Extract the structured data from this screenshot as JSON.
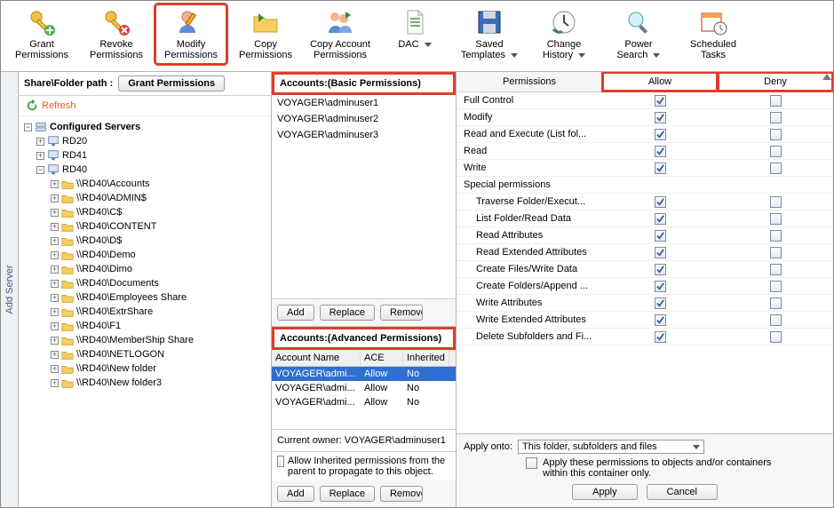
{
  "toolbar": [
    {
      "id": "grant-permissions",
      "label": "Grant\nPermissions",
      "icon": "key-plus",
      "dropdown": false
    },
    {
      "id": "revoke-permissions",
      "label": "Revoke\nPermissions",
      "icon": "key-x",
      "dropdown": false
    },
    {
      "id": "modify-permissions",
      "label": "Modify\nPermissions",
      "icon": "user-pencil",
      "highlight": true,
      "dropdown": false
    },
    {
      "id": "copy-permissions",
      "label": "Copy\nPermissions",
      "icon": "folder-arrow",
      "dropdown": false
    },
    {
      "id": "copy-account-permissions",
      "label": "Copy Account\nPermissions",
      "icon": "users-arrow",
      "dropdown": false
    },
    {
      "id": "dac",
      "label": "DAC",
      "icon": "document",
      "dropdown": true
    },
    {
      "id": "saved-templates",
      "label": "Saved\nTemplates",
      "icon": "floppy",
      "dropdown": true
    },
    {
      "id": "change-history",
      "label": "Change\nHistory",
      "icon": "clock",
      "dropdown": true
    },
    {
      "id": "power-search",
      "label": "Power\nSearch",
      "icon": "magnifier",
      "dropdown": true
    },
    {
      "id": "scheduled-tasks",
      "label": "Scheduled\nTasks",
      "icon": "calendar-clock",
      "dropdown": false
    }
  ],
  "side_tab": "Add Server",
  "left": {
    "path_label": "Share\\Folder path :",
    "grant_btn": "Grant Permissions",
    "refresh": "Refresh",
    "root": "Configured Servers",
    "servers": [
      {
        "name": "RD20",
        "expanded": false
      },
      {
        "name": "RD41",
        "expanded": false
      },
      {
        "name": "RD40",
        "expanded": true,
        "children": [
          "\\\\RD40\\Accounts",
          "\\\\RD40\\ADMIN$",
          "\\\\RD40\\C$",
          "\\\\RD40\\CONTENT",
          "\\\\RD40\\D$",
          "\\\\RD40\\Demo",
          "\\\\RD40\\Dimo",
          "\\\\RD40\\Documents",
          "\\\\RD40\\Employees Share",
          "\\\\RD40\\ExtrShare",
          "\\\\RD40\\F1",
          "\\\\RD40\\MemberShip Share",
          "\\\\RD40\\NETLOGON",
          "\\\\RD40\\New folder",
          "\\\\RD40\\New folder3"
        ]
      }
    ]
  },
  "mid": {
    "basic_header": "Accounts:(Basic Permissions)",
    "basic_accounts": [
      "VOYAGER\\adminuser1",
      "VOYAGER\\adminuser2",
      "VOYAGER\\adminuser3"
    ],
    "btn_add": "Add",
    "btn_replace": "Replace",
    "btn_remove": "Remove",
    "adv_header": "Accounts:(Advanced Permissions)",
    "adv_cols": {
      "name": "Account Name",
      "ace": "ACE",
      "inherited": "Inherited"
    },
    "adv_rows": [
      {
        "name": "VOYAGER\\admi...",
        "ace": "Allow",
        "inherited": "No",
        "selected": true
      },
      {
        "name": "VOYAGER\\admi...",
        "ace": "Allow",
        "inherited": "No"
      },
      {
        "name": "VOYAGER\\admi...",
        "ace": "Allow",
        "inherited": "No"
      }
    ],
    "owner_label": "Current owner: VOYAGER\\adminuser1",
    "inherit_label": "Allow Inherited permissions from the parent to propagate to this object."
  },
  "right": {
    "head_perm": "Permissions",
    "head_allow": "Allow",
    "head_deny": "Deny",
    "rows": [
      {
        "label": "Full Control",
        "allow": true,
        "deny": false
      },
      {
        "label": "Modify",
        "allow": true,
        "deny": false
      },
      {
        "label": "Read and Execute (List fol...",
        "allow": true,
        "deny": false
      },
      {
        "label": "Read",
        "allow": true,
        "deny": false
      },
      {
        "label": "Write",
        "allow": true,
        "deny": false
      },
      {
        "label": "Special permissions",
        "allow": null,
        "deny": null,
        "section": true
      },
      {
        "label": "Traverse Folder/Execut...",
        "allow": true,
        "deny": false,
        "sub": true
      },
      {
        "label": "List Folder/Read Data",
        "allow": true,
        "deny": false,
        "sub": true
      },
      {
        "label": "Read Attributes",
        "allow": true,
        "deny": false,
        "sub": true
      },
      {
        "label": "Read Extended Attributes",
        "allow": true,
        "deny": false,
        "sub": true
      },
      {
        "label": "Create Files/Write Data",
        "allow": true,
        "deny": false,
        "sub": true
      },
      {
        "label": "Create Folders/Append ...",
        "allow": true,
        "deny": false,
        "sub": true
      },
      {
        "label": "Write Attributes",
        "allow": true,
        "deny": false,
        "sub": true
      },
      {
        "label": "Write Extended Attributes",
        "allow": true,
        "deny": false,
        "sub": true
      },
      {
        "label": "Delete Subfolders and Fi...",
        "allow": true,
        "deny": false,
        "sub": true
      }
    ],
    "apply_onto_label": "Apply onto:",
    "apply_onto_value": "This folder, subfolders and files",
    "apply_check_label": "Apply these permissions to objects and/or containers within this container only.",
    "btn_apply": "Apply",
    "btn_cancel": "Cancel"
  }
}
